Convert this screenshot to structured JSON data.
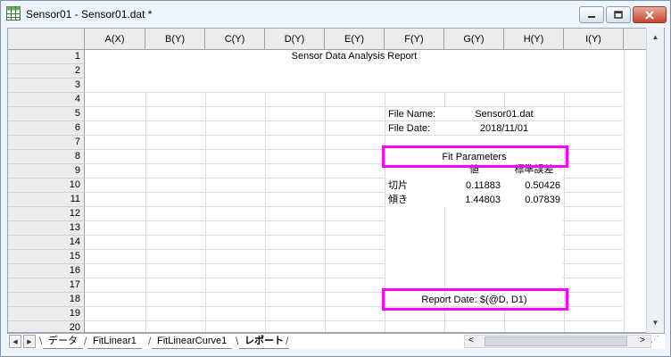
{
  "window": {
    "title": "Sensor01 - Sensor01.dat *",
    "controls": {
      "minimize": "minimize",
      "maximize": "maximize",
      "close": "close"
    }
  },
  "columns": [
    "A(X)",
    "B(Y)",
    "C(Y)",
    "D(Y)",
    "E(Y)",
    "F(Y)",
    "G(Y)",
    "H(Y)",
    "I(Y)"
  ],
  "rows": [
    "1",
    "2",
    "3",
    "4",
    "5",
    "6",
    "7",
    "8",
    "9",
    "10",
    "11",
    "12",
    "13",
    "14",
    "15",
    "16",
    "17",
    "18",
    "19",
    "20"
  ],
  "report": {
    "title": "Sensor Data Analysis Report",
    "file_name_label": "File Name:",
    "file_name_value": "Sensor01.dat",
    "file_date_label": "File Date:",
    "file_date_value": "2018/11/01",
    "fit_parameters_header": "Fit Parameters",
    "value_header": "値",
    "std_error_header": "標準誤差",
    "intercept_label": "切片",
    "intercept_value": "0.11883",
    "intercept_error": "0.50426",
    "slope_label": "傾き",
    "slope_value": "1.44803",
    "slope_error": "0.07839",
    "report_date": "Report Date: $(@D, D1)"
  },
  "tabs": [
    {
      "label": "データ",
      "active": false
    },
    {
      "label": "FitLinear1",
      "active": false
    },
    {
      "label": "FitLinearCurve1",
      "active": false
    },
    {
      "label": "レポート",
      "active": true
    }
  ],
  "colors": {
    "highlight": "#ff00ff",
    "header_bg": "#ececec",
    "grid_line": "#dcdcdc"
  }
}
